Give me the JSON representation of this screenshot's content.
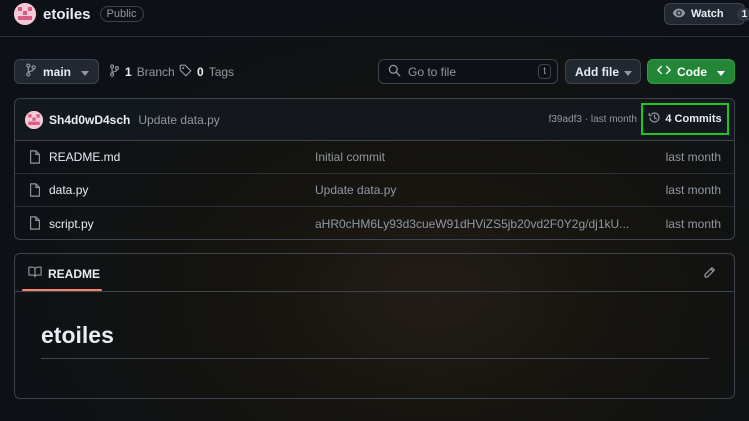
{
  "repo": {
    "name": "etoiles",
    "visibility": "Public"
  },
  "watch": {
    "label": "Watch",
    "count": "1"
  },
  "toolbar": {
    "branch": "main",
    "branches_count": "1",
    "branches_label": "Branch",
    "tags_count": "0",
    "tags_label": "Tags",
    "search_placeholder": "Go to file",
    "search_shortcut": "t",
    "add_file_label": "Add file",
    "code_label": "Code"
  },
  "latest_commit": {
    "author": "Sh4d0wD4sch",
    "message": "Update data.py",
    "hash": "f39adf3",
    "age": "last month",
    "commits_label": "4 Commits"
  },
  "files": [
    {
      "name": "README.md",
      "commit": "Initial commit",
      "date": "last month"
    },
    {
      "name": "data.py",
      "commit": "Update data.py",
      "date": "last month"
    },
    {
      "name": "script.py",
      "commit": "aHR0cHM6Ly93d3cueW91dHViZS5jb20vd2F0Y2g/dj1kU...",
      "date": "last month"
    }
  ],
  "readme": {
    "tab_label": "README",
    "heading": "etoiles"
  },
  "colors": {
    "accent_green": "#238636",
    "highlight_box": "#22c51c",
    "tab_underline": "#f78166"
  }
}
